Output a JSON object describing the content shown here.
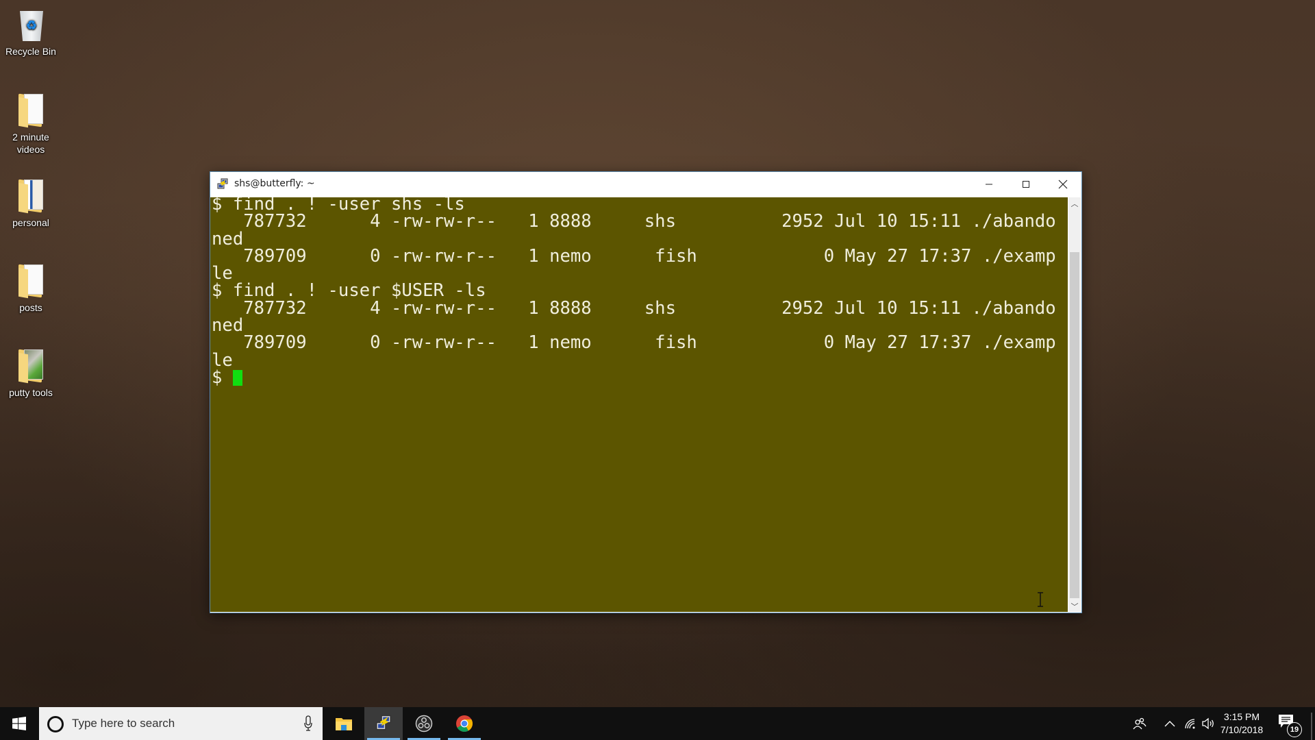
{
  "desktop": {
    "icons": [
      {
        "label": "Recycle Bin",
        "icon": "recycle-bin-icon"
      },
      {
        "label": "2 minute videos",
        "icon": "folder-icon"
      },
      {
        "label": "personal",
        "icon": "folder-icon"
      },
      {
        "label": "posts",
        "icon": "folder-icon"
      },
      {
        "label": "putty tools",
        "icon": "folder-icon"
      }
    ]
  },
  "window": {
    "title": "shs@butterfly: ~",
    "app_icon": "putty-icon",
    "controls": {
      "minimize": "minimize-icon",
      "maximize": "maximize-icon",
      "close": "close-icon"
    }
  },
  "terminal": {
    "lines": [
      "$ find . ! -user shs -ls",
      "   787732      4 -rw-rw-r--   1 8888     shs          2952 Jul 10 15:11 ./abando",
      "ned",
      "   789709      0 -rw-rw-r--   1 nemo      fish            0 May 27 17:37 ./examp",
      "le",
      "$ find . ! -user $USER -ls",
      "   787732      4 -rw-rw-r--   1 8888     shs          2952 Jul 10 15:11 ./abando",
      "ned",
      "   789709      0 -rw-rw-r--   1 nemo      fish            0 May 27 17:37 ./examp",
      "le"
    ],
    "prompt": "$ ",
    "background_color": "#5c5500",
    "text_color": "#f0eedc",
    "cursor_color": "#11dd11"
  },
  "taskbar": {
    "search_placeholder": "Type here to search",
    "apps": [
      {
        "name": "File Explorer",
        "icon": "file-explorer-icon",
        "active": false
      },
      {
        "name": "PuTTY",
        "icon": "putty-icon",
        "active": true
      },
      {
        "name": "OBS Studio",
        "icon": "obs-icon",
        "active": false
      },
      {
        "name": "Google Chrome",
        "icon": "chrome-icon",
        "active": false
      }
    ],
    "clock": {
      "time": "3:15 PM",
      "date": "7/10/2018"
    },
    "notification_count": "19"
  }
}
